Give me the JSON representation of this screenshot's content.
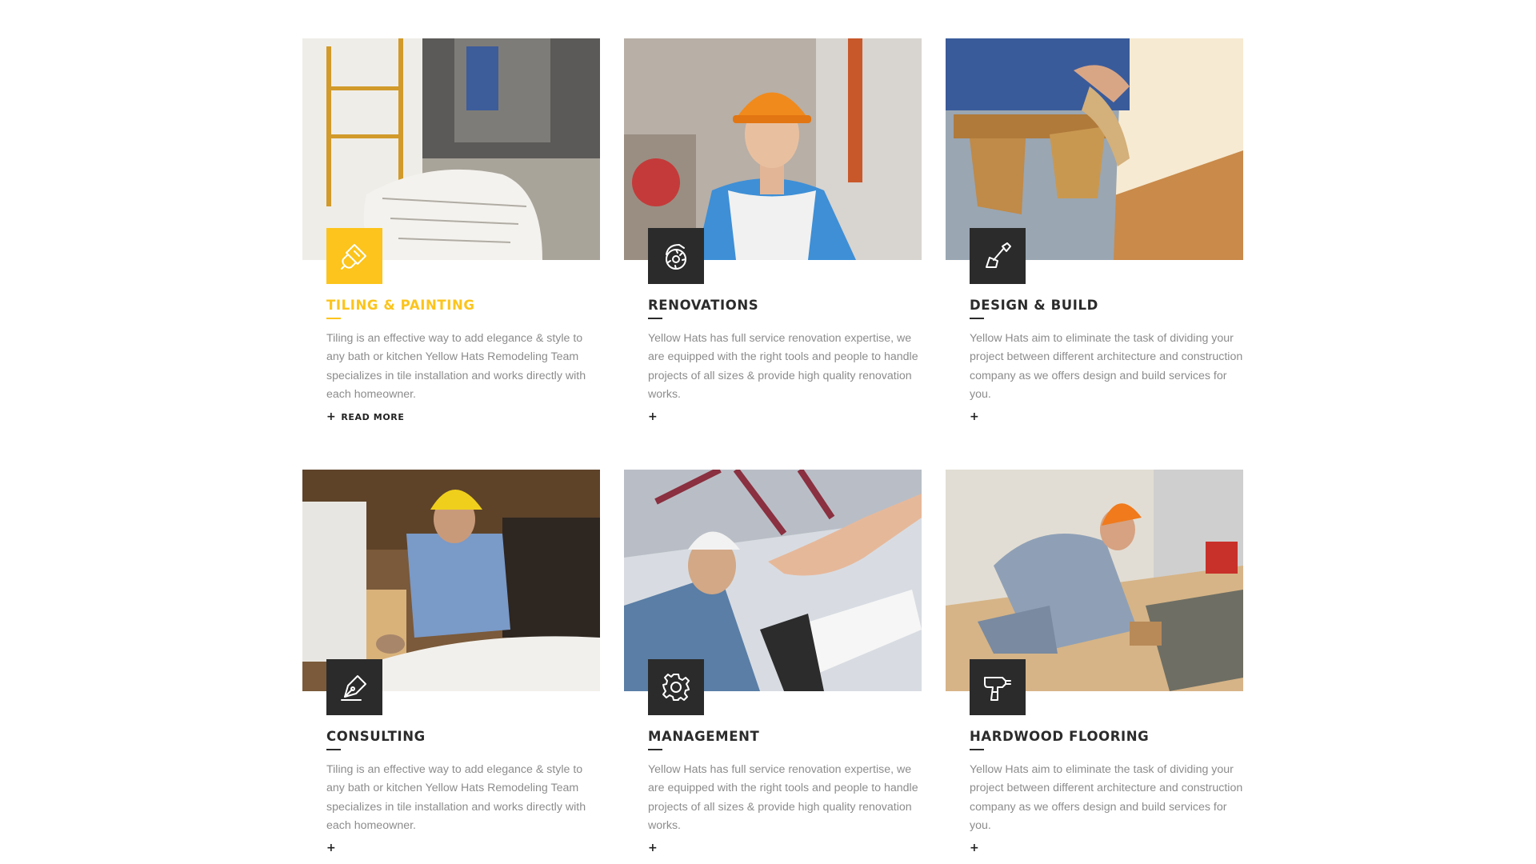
{
  "services": [
    {
      "title": "TILING & PAINTING",
      "description": "Tiling is an effective way to add elegance & style to any bath or kitchen Yellow Hats Remodeling Team specializes in tile installation and works directly with each homeowner.",
      "more_symbol": "+",
      "more_label": "READ MORE",
      "icon": "paint-brush-icon",
      "photo": "construction-site-with-blueprints-photo",
      "highlighted": true
    },
    {
      "title": "RENOVATIONS",
      "description": "Yellow Hats has full service renovation expertise, we are equipped with the right tools and people to handle projects of all sizes & provide high quality renovation works.",
      "more_symbol": "+",
      "more_label": "",
      "icon": "circular-saw-icon",
      "photo": "smiling-worker-in-hard-hat-photo",
      "highlighted": false
    },
    {
      "title": "DESIGN & BUILD",
      "description": "Yellow Hats aim to eliminate the task of dividing your project between different architecture and construction company as we offers design and build services for you.",
      "more_symbol": "+",
      "more_label": "",
      "icon": "trowel-icon",
      "photo": "worker-with-tool-belt-photo",
      "highlighted": false
    },
    {
      "title": "CONSULTING",
      "description": "Tiling is an effective way to add elegance & style to any bath or kitchen Yellow Hats Remodeling Team specializes in tile installation and works directly with each homeowner.",
      "more_symbol": "+",
      "more_label": "",
      "icon": "pen-nib-icon",
      "photo": "worker-drawing-plans-photo",
      "highlighted": false
    },
    {
      "title": "MANAGEMENT",
      "description": "Yellow Hats has full service renovation expertise, we are equipped with the right tools and people to handle projects of all sizes & provide high quality renovation works.",
      "more_symbol": "+",
      "more_label": "",
      "icon": "gear-icon",
      "photo": "handshake-with-blueprints-photo",
      "highlighted": false
    },
    {
      "title": "HARDWOOD FLOORING",
      "description": "Yellow Hats aim to eliminate the task of dividing your project between different architecture and construction company as we offers design and build services for you.",
      "more_symbol": "+",
      "more_label": "",
      "icon": "power-drill-icon",
      "photo": "worker-laying-floor-tiles-photo",
      "highlighted": false
    }
  ],
  "colors": {
    "accent": "#fcc41c",
    "icon_box": "#2b2b2b",
    "title": "#2b2b2b",
    "body_text": "#8c8c8c"
  }
}
